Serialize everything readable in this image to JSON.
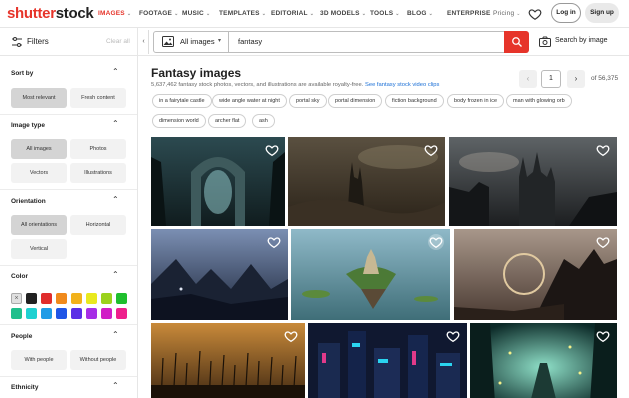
{
  "brand": {
    "part1": "shutter",
    "part2": "stock",
    "color": "#e6342a"
  },
  "nav": {
    "items": [
      {
        "label": "IMAGES",
        "active": true
      },
      {
        "label": "FOOTAGE"
      },
      {
        "label": "MUSIC"
      },
      {
        "label": "TEMPLATES"
      },
      {
        "label": "EDITORIAL"
      },
      {
        "label": "3D MODELS"
      },
      {
        "label": "TOOLS"
      },
      {
        "label": "BLOG"
      },
      {
        "label": "ENTERPRISE"
      }
    ],
    "pricing": "Pricing",
    "login": "Log in",
    "signup": "Sign up"
  },
  "search": {
    "filters_label": "Filters",
    "clear_all": "Clear all",
    "type_label": "All images",
    "query": "fantasy",
    "search_by_image": "Search by image"
  },
  "sidebar": {
    "sort_by": {
      "title": "Sort by",
      "options": [
        "Most relevant",
        "Fresh content"
      ],
      "selected": "Most relevant"
    },
    "image_type": {
      "title": "Image type",
      "options": [
        "All images",
        "Photos",
        "Vectors",
        "Illustrations"
      ],
      "selected": "All images"
    },
    "orientation": {
      "title": "Orientation",
      "options": [
        "All orientations",
        "Horizontal",
        "Vertical"
      ],
      "selected": "All orientations"
    },
    "color": {
      "title": "Color",
      "swatches": [
        "#e0e0e0",
        "#222222",
        "#e02d2d",
        "#f08a1c",
        "#f2b21b",
        "#e9e91e",
        "#9bd21c",
        "#1fbf2d",
        "#1fbf8c",
        "#1ed1d1",
        "#1f9be6",
        "#1f55e6",
        "#5a2ee6",
        "#a62ee6",
        "#d11ec6",
        "#ee1f8c"
      ]
    },
    "people": {
      "title": "People",
      "options": [
        "With people",
        "Without people"
      ]
    },
    "ethnicity": {
      "title": "Ethnicity"
    }
  },
  "results": {
    "title": "Fantasy images",
    "subtitle": "5,637,462 fantasy stock photos, vectors, and illustrations are available royalty-free.",
    "video_link": "See fantasy stock video clips",
    "page": "1",
    "total_pages": "of 56,375",
    "tags": [
      "in a fairytale castle",
      "wide angle water at night",
      "portal sky",
      "portal dimension",
      "fiction background",
      "body frozen in ice",
      "man with glowing orb",
      "dimension world",
      "archer flat",
      "ash"
    ]
  }
}
